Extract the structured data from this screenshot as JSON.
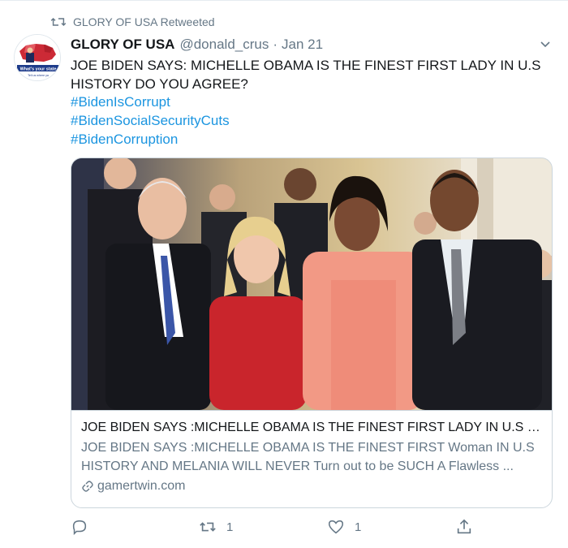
{
  "retweet": {
    "label": "GLORY OF USA Retweeted"
  },
  "author": {
    "name": "GLORY OF USA",
    "handle": "@donald_crus",
    "separator": "·",
    "date": "Jan 21"
  },
  "avatar": {
    "banner_text": "What's your state",
    "sub_text": "Tell us where ya"
  },
  "tweet": {
    "text": "JOE BIDEN SAYS: MICHELLE OBAMA IS THE FINEST FIRST LADY IN U.S HISTORY DO YOU AGREE?",
    "hashtags": [
      "#BidenIsCorrupt",
      "#BidenSocialSecurityCuts",
      "#BidenCorruption"
    ]
  },
  "card": {
    "title": "JOE BIDEN SAYS :MICHELLE OBAMA IS THE FINEST FIRST LADY IN U.S H...",
    "description_line1": "JOE BIDEN SAYS :MICHELLE OBAMA IS THE FINEST FIRST Woman IN U.S",
    "description_line2": "HISTORY AND MELANIA WILL NEVER Turn out to be SUCH A Flawless ...",
    "domain": "gamertwin.com"
  },
  "actions": {
    "reply_count": "",
    "retweet_count": "1",
    "like_count": "1"
  },
  "colors": {
    "link": "#1b95e0",
    "secondary": "#657786",
    "border": "#ccd6dd"
  },
  "icons": [
    "retweet-icon",
    "chevron-down-icon",
    "link-icon",
    "reply-icon",
    "like-icon",
    "share-icon"
  ]
}
